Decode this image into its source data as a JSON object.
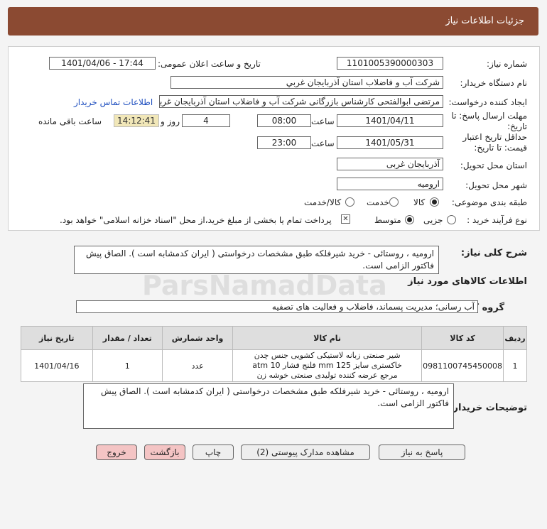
{
  "header": {
    "title": "جزئیات اطلاعات نیاز"
  },
  "fields": {
    "need_number_label": "شماره نیاز:",
    "need_number": "1101005390000303",
    "announce_label": "تاریخ و ساعت اعلان عمومی:",
    "announce_value": "1401/04/06 - 17:44",
    "buyer_org_label": "نام دستگاه خریدار:",
    "buyer_org": "شرکت آب و فاضلاب استان آذربایجان غربي",
    "creator_label": "ایجاد کننده درخواست:",
    "creator": "مرتضی ابوالفتحی کارشناس بازرگانی شرکت آب و فاضلاب استان آذربایجان غربی",
    "contact_link": "اطلاعات تماس خریدار",
    "deadline_label": "مهلت ارسال پاسخ: تا تاریخ:",
    "deadline_date": "1401/04/11",
    "time_label": "ساعت",
    "deadline_time": "08:00",
    "days": "4",
    "days_label": "روز و",
    "remaining_time": "14:12:41",
    "remaining_label": "ساعت باقی مانده",
    "validity_label": "حداقل تاریخ اعتبار قیمت: تا تاریخ:",
    "validity_date": "1401/05/31",
    "validity_time": "23:00",
    "province_label": "استان محل تحویل:",
    "province": "آذربایجان غربی",
    "city_label": "شهر محل تحویل:",
    "city": "ارومیه",
    "category_label": "طبقه بندی موضوعی:",
    "category_options": [
      "کالا",
      "خدمت",
      "کالا/خدمت"
    ],
    "purchase_type_label": "نوع فرآیند خرید :",
    "purchase_options": [
      "جزیی",
      "متوسط"
    ],
    "purchase_note": "پرداخت تمام یا بخشی از مبلغ خرید،از محل \"اسناد خزانه اسلامی\" خواهد بود."
  },
  "summary": {
    "label": "شرح کلی نیاز:",
    "text": "ارومیه ، روستائی -  خرید شیرفلکه طبق مشخصات درخواستی ( ایران کدمشابه است ). الصاق پیش فاکتور الزامی است."
  },
  "goods_info": {
    "title": "اطلاعات کالاهای مورد نیاز"
  },
  "goods_group": {
    "label": "گروه کالا:",
    "value": "آب رسانی؛ مدیریت پسماند، فاضلاب و فعالیت های تصفیه"
  },
  "table": {
    "headers": [
      "ردیف",
      "کد کالا",
      "نام کالا",
      "واحد شمارش",
      "تعداد / مقدار",
      "تاریخ نیاز"
    ],
    "rows": [
      {
        "row": "1",
        "code": "0981100745450008",
        "name": "شیر صنعتی زبانه لاستیکی کشویی جنس چدن خاکستری سایز 125 mm فلنج فشار 10 atm مرجع عرضه کننده تولیدی صنعتی خوشه زن",
        "unit": "عدد",
        "qty": "1",
        "date": "1401/04/16"
      }
    ]
  },
  "buyer_desc": {
    "label": "توضیحات خریدار:",
    "text": "ارومیه ، روستائی -  خرید شیرفلکه طبق مشخصات درخواستی ( ایران کدمشابه است ). الصاق پیش فاکتور الزامی است."
  },
  "buttons": {
    "reply": "پاسخ به نیاز",
    "attachments": "مشاهده مدارک پیوستی (2)",
    "print": "چاپ",
    "back": "بازگشت",
    "exit": "خروج"
  },
  "watermark": {
    "brand": "ParsNamadData"
  }
}
